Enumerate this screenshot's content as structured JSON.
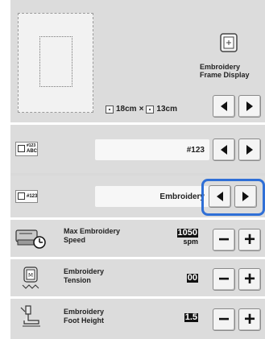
{
  "frame_section": {
    "label_line1": "Embroidery",
    "label_line2": "Frame Display",
    "size_w": "18cm",
    "size_sep": "×",
    "size_h": "13cm"
  },
  "font_code_row": {
    "icon_top": "#123",
    "icon_bottom": "ABC",
    "value": "#123"
  },
  "thread_color_row": {
    "icon_text": "#123",
    "value": "Embroidery"
  },
  "settings": [
    {
      "label_line1": "Max Embroidery",
      "label_line2": "Speed",
      "value": "1050",
      "unit": "spm",
      "icon": "sewing-machine-speed-icon"
    },
    {
      "label_line1": "Embroidery",
      "label_line2": "Tension",
      "value": "00",
      "unit": "",
      "icon": "thread-tension-icon"
    },
    {
      "label_line1": "Embroidery",
      "label_line2": "Foot Height",
      "value": "1.5",
      "unit": "",
      "icon": "embroidery-foot-icon"
    }
  ],
  "accent_color": "#2f6fd6"
}
